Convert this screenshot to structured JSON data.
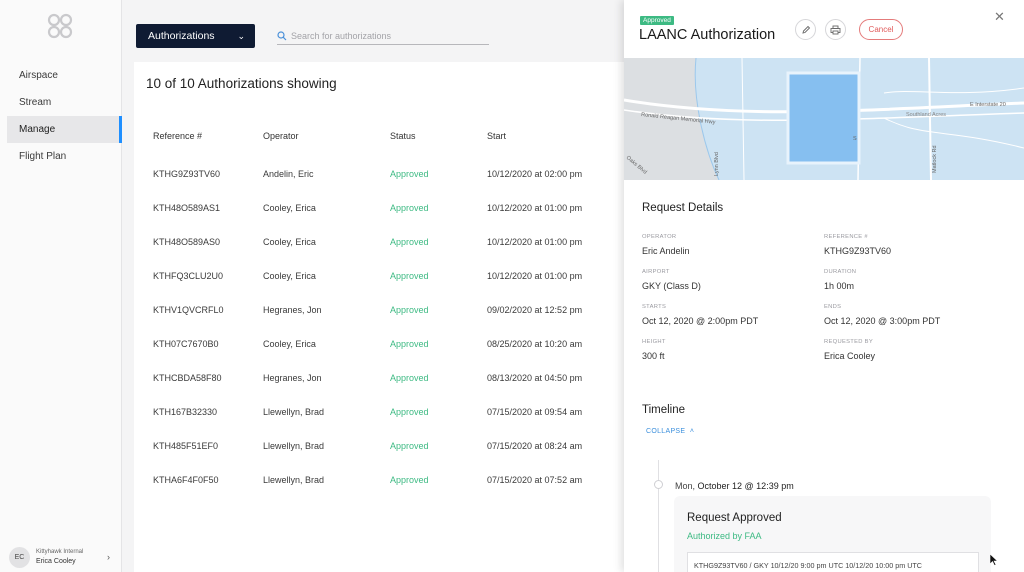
{
  "sidebar": {
    "items": [
      {
        "label": "Airspace"
      },
      {
        "label": "Stream"
      },
      {
        "label": "Manage"
      },
      {
        "label": "Flight Plan"
      }
    ],
    "user": {
      "initials": "EC",
      "org": "Kittyhawk Internal",
      "name": "Erica Cooley"
    }
  },
  "topbar": {
    "dropdown_label": "Authorizations",
    "search_placeholder": "Search for authorizations"
  },
  "list": {
    "count_text": "10 of 10 Authorizations showing",
    "columns": [
      "Reference #",
      "Operator",
      "Status",
      "Start"
    ],
    "rows": [
      {
        "ref": "KTHG9Z93TV60",
        "operator": "Andelin, Eric",
        "status": "Approved",
        "start": "10/12/2020 at 02:00 pm"
      },
      {
        "ref": "KTH48O589AS1",
        "operator": "Cooley, Erica",
        "status": "Approved",
        "start": "10/12/2020 at 01:00 pm"
      },
      {
        "ref": "KTH48O589AS0",
        "operator": "Cooley, Erica",
        "status": "Approved",
        "start": "10/12/2020 at 01:00 pm"
      },
      {
        "ref": "KTHFQ3CLU2U0",
        "operator": "Cooley, Erica",
        "status": "Approved",
        "start": "10/12/2020 at 01:00 pm"
      },
      {
        "ref": "KTHV1QVCRFL0",
        "operator": "Hegranes, Jon",
        "status": "Approved",
        "start": "09/02/2020 at 12:52 pm"
      },
      {
        "ref": "KTH07C7670B0",
        "operator": "Cooley, Erica",
        "status": "Approved",
        "start": "08/25/2020 at 10:20 am"
      },
      {
        "ref": "KTHCBDA58F80",
        "operator": "Hegranes, Jon",
        "status": "Approved",
        "start": "08/13/2020 at 04:50 pm"
      },
      {
        "ref": "KTH167B32330",
        "operator": "Llewellyn, Brad",
        "status": "Approved",
        "start": "07/15/2020 at 09:54 am"
      },
      {
        "ref": "KTH485F51EF0",
        "operator": "Llewellyn, Brad",
        "status": "Approved",
        "start": "07/15/2020 at 08:24 am"
      },
      {
        "ref": "KTHA6F4F0F50",
        "operator": "Llewellyn, Brad",
        "status": "Approved",
        "start": "07/15/2020 at 07:52 am"
      }
    ]
  },
  "panel": {
    "badge": "Approved",
    "title": "LAANC Authorization",
    "cancel_label": "Cancel",
    "map": {
      "streets": [
        "Ronald Reagan Memorial Hwy",
        "Southland Acres",
        "E Interstate 20",
        "Matlock Rd",
        "Lynn Blvd",
        "Oaks Blvd",
        "S"
      ]
    },
    "details_title": "Request Details",
    "details": {
      "operator": {
        "label": "OPERATOR",
        "value": "Eric Andelin"
      },
      "reference": {
        "label": "REFERENCE #",
        "value": "KTHG9Z93TV60"
      },
      "airport": {
        "label": "AIRPORT",
        "value": "GKY (Class D)"
      },
      "duration": {
        "label": "DURATION",
        "value": "1h 00m"
      },
      "starts": {
        "label": "STARTS",
        "value": "Oct 12, 2020 @ 2:00pm PDT"
      },
      "ends": {
        "label": "ENDS",
        "value": "Oct 12, 2020 @ 3:00pm PDT"
      },
      "height": {
        "label": "HEIGHT",
        "value": "300 ft"
      },
      "requested_by": {
        "label": "REQUESTED BY",
        "value": "Erica Cooley"
      }
    },
    "timeline_title": "Timeline",
    "collapse_label": "COLLAPSE",
    "timeline": {
      "day": "Mon, ",
      "date": "October 12 @ 12:39 pm",
      "card_title": "Request Approved",
      "card_sub": "Authorized by FAA",
      "card_detail": "KTHG9Z93TV60 / GKY 10/12/20 9:00 pm UTC 10/12/20 10:00 pm UTC"
    }
  },
  "colors": {
    "accent": "#1f8fff",
    "approved": "#3dba83",
    "dropdown": "#0f1b33",
    "cancel": "#e05a5a"
  }
}
